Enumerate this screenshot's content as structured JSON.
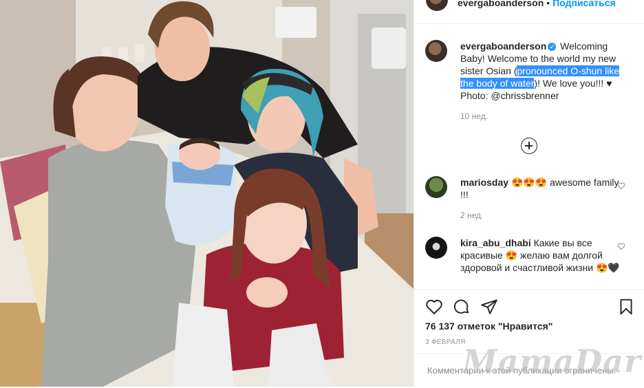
{
  "header": {
    "username": "evergaboanderson",
    "separator": "•",
    "follow_label": "Подписаться"
  },
  "post": {
    "author": "evergaboanderson",
    "caption_before": "Welcoming Baby! Welcome to the world my new sister Osian (",
    "caption_highlight": "pronounced O-shun like the body of water",
    "caption_after": ")! We love you!!! ♥ Photo: @chrissbrenner",
    "time": "10 нед."
  },
  "comments": [
    {
      "username": "mariosday",
      "text": "😍😍😍 awesome family !!!",
      "time": "2 нед."
    },
    {
      "username": "kira_abu_dhabi",
      "text": "Какие вы все красивые 😍 желаю вам долгой здоровой и счастливой жизни 😍🖤"
    }
  ],
  "icons": {
    "like": "heart-icon",
    "comment": "comment-icon",
    "share": "share-icon",
    "save": "bookmark-icon",
    "load_more": "plus-circle-icon",
    "verified": "verified-badge-icon"
  },
  "stats": {
    "likes": "76 137 отметок \"Нравится\""
  },
  "date": "3 ФЕВРАЛЯ",
  "comment_input": {
    "placeholder": "Комментарии к этой публикации ограничены."
  },
  "watermark": "MamaDar",
  "colors": {
    "accent": "#0095f6",
    "highlight": "#3390ff",
    "muted": "#8e8e8e"
  }
}
